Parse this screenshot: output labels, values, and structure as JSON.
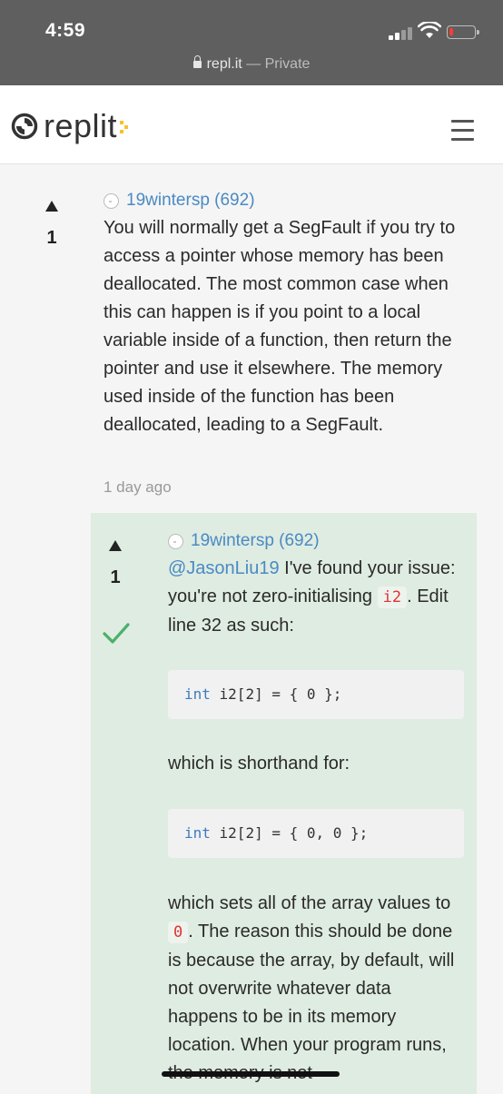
{
  "status_bar": {
    "time": "4:59",
    "url_domain": "repl.it",
    "url_suffix": " — Private"
  },
  "header": {
    "logo_text": "replit",
    "logo_dot_color": "#f7c325",
    "menu_icon": "hamburger-icon"
  },
  "answer": {
    "votes": "1",
    "author": "19wintersp (692)",
    "text": "You will normally get a SegFault if you try to access a pointer whose memory has been deallocated. The most common case when this can happen is if you point to a local variable inside of a function, then return the pointer and use it elsewhere. The memory used inside of the function has been deallocated, leading to a SegFault.",
    "time": "1 day ago"
  },
  "reply": {
    "votes": "1",
    "accepted_icon": "checkmark-icon",
    "author": "19wintersp (692)",
    "mention": "@JasonLiu19",
    "p1_text_a": " I've found your issue: you're not zero-initialising ",
    "p1_code": "i2",
    "p1_text_b": ". Edit line 32 as such:",
    "code1_kw": "int",
    "code1_rest": " i2[2] = { 0 };",
    "p2": "which is shorthand for:",
    "code2_kw": "int",
    "code2_rest": " i2[2] = { 0, 0 };",
    "p3_text_a": "which sets all of the array values to ",
    "p3_code": "0",
    "p3_text_b": ". The reason this should be done is because the array, by default, will not overwrite whatever data happens to be in its memory location. When your program runs, the memory is not"
  },
  "colors": {
    "status_bar_bg": "#5f5f5f",
    "link": "#4a8ac4",
    "reply_bg": "#dfece1",
    "accepted": "#4caf6a"
  }
}
